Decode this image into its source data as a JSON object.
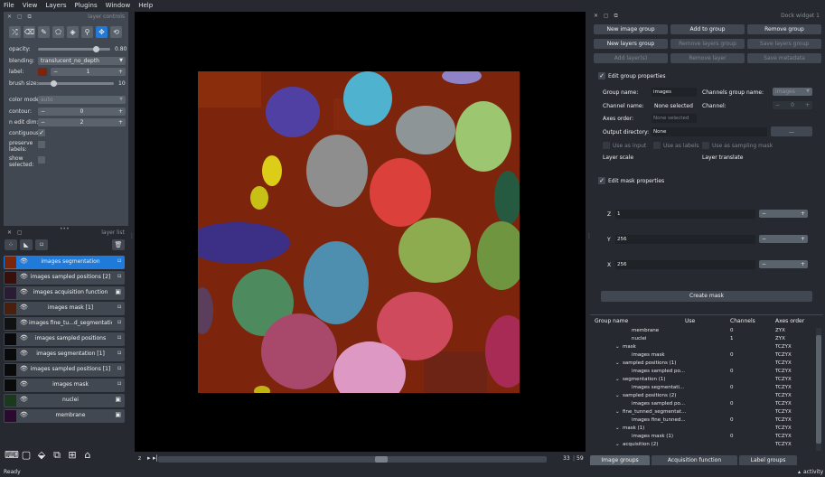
{
  "menu": [
    "File",
    "View",
    "Layers",
    "Plugins",
    "Window",
    "Help"
  ],
  "layer_controls": {
    "title": "layer controls",
    "opacity_label": "opacity:",
    "opacity_value": "0.80",
    "opacity_level": 0.8,
    "blending_label": "blending:",
    "blending_value": "translucent_no_depth",
    "label_label": "label:",
    "label_value": "1",
    "label_color": "#7a260c",
    "brush_label": "brush size:",
    "brush_value": "10",
    "brush_level": 0.2,
    "color_mode_label": "color mode:",
    "color_mode_value": "auto",
    "contour_label": "contour:",
    "contour_value": "0",
    "n_edit_label": "n edit dim:",
    "n_edit_value": "2",
    "contiguous_label": "contiguous:",
    "contiguous_checked": true,
    "preserve_label": "preserve\nlabels:",
    "show_selected_label": "show\nselected:"
  },
  "layer_list": {
    "title": "layer list",
    "layers": [
      {
        "name": "images segmentation",
        "selected": true,
        "type": "labels"
      },
      {
        "name": "images sampled positions [2]",
        "selected": false,
        "type": "labels"
      },
      {
        "name": "images acquisition function",
        "selected": false,
        "type": "image"
      },
      {
        "name": "images mask [1]",
        "selected": false,
        "type": "labels"
      },
      {
        "name": "images fine_tu...d_segmentation",
        "selected": false,
        "type": "labels"
      },
      {
        "name": "images sampled positions",
        "selected": false,
        "type": "labels"
      },
      {
        "name": "images segmentation [1]",
        "selected": false,
        "type": "labels"
      },
      {
        "name": "images sampled positions [1]",
        "selected": false,
        "type": "labels"
      },
      {
        "name": "images mask",
        "selected": false,
        "type": "labels"
      },
      {
        "name": "nuclei",
        "selected": false,
        "type": "image"
      },
      {
        "name": "membrane",
        "selected": false,
        "type": "image"
      }
    ]
  },
  "dims": {
    "left_value": "33",
    "right_value": "59"
  },
  "right_dock": {
    "title": "Dock widget 1",
    "buttons_row1": [
      "New image group",
      "Add to group",
      "Remove group"
    ],
    "buttons_row2": [
      "New layers group",
      "Remove layers group",
      "Save layers group"
    ],
    "buttons_row3": [
      "Add layer(s)",
      "Remove layer",
      "Save metadata"
    ],
    "edit_group_props": "Edit group properties",
    "group_name_label": "Group name:",
    "group_name_value": "images",
    "channels_group_label": "Channels group name:",
    "channels_group_value": "images",
    "channel_name_label": "Channel name:",
    "channel_name_value": "None selected",
    "channel_label": "Channel:",
    "channel_value": "0",
    "axes_order_label": "Axes order:",
    "axes_order_value": "None selected",
    "output_dir_label": "Output directory:",
    "output_dir_value": "None",
    "output_dir_button": "...",
    "use_as_input": "Use as input",
    "use_as_labels": "Use as labels",
    "use_as_sampling": "Use as sampling mask",
    "layer_scale": "Layer scale",
    "layer_translate": "Layer translate",
    "edit_mask_props": "Edit mask properties",
    "z_label": "Z",
    "z_value": "1",
    "y_label": "Y",
    "y_value": "256",
    "x_label": "X",
    "x_value": "256",
    "create_mask": "Create mask"
  },
  "tree": {
    "headers": [
      "Group name",
      "Use",
      "Channels",
      "Axes order"
    ],
    "rows": [
      {
        "name": "membrane",
        "indent": 2,
        "channels": "0",
        "axes": "ZYX"
      },
      {
        "name": "nuclei",
        "indent": 2,
        "channels": "1",
        "axes": "ZYX"
      },
      {
        "name": "mask",
        "indent": 1,
        "channels": "",
        "axes": "TCZYX"
      },
      {
        "name": "images mask",
        "indent": 2,
        "channels": "0",
        "axes": "TCZYX"
      },
      {
        "name": "sampled positions (1)",
        "indent": 1,
        "channels": "",
        "axes": "TCZYX"
      },
      {
        "name": "images sampled po...",
        "indent": 2,
        "channels": "0",
        "axes": "TCZYX"
      },
      {
        "name": "segmentation (1)",
        "indent": 1,
        "channels": "",
        "axes": "TCZYX"
      },
      {
        "name": "images segmentati...",
        "indent": 2,
        "channels": "0",
        "axes": "TCZYX"
      },
      {
        "name": "sampled positions (2)",
        "indent": 1,
        "channels": "",
        "axes": "TCZYX"
      },
      {
        "name": "images sampled po...",
        "indent": 2,
        "channels": "0",
        "axes": "TCZYX"
      },
      {
        "name": "fine_tunned_segmentat...",
        "indent": 1,
        "channels": "",
        "axes": "TCZYX"
      },
      {
        "name": "images fine_tunned...",
        "indent": 2,
        "channels": "0",
        "axes": "TCZYX"
      },
      {
        "name": "mask (1)",
        "indent": 1,
        "channels": "",
        "axes": "TCZYX"
      },
      {
        "name": "images mask (1)",
        "indent": 2,
        "channels": "0",
        "axes": "TCZYX"
      },
      {
        "name": "acquisition (2)",
        "indent": 1,
        "channels": "",
        "axes": "TCZYX"
      }
    ]
  },
  "tabs": [
    "Image groups manager",
    "Acquisition function configuration",
    "Label groups manager"
  ],
  "status": {
    "left": "Ready",
    "right": "activity"
  }
}
